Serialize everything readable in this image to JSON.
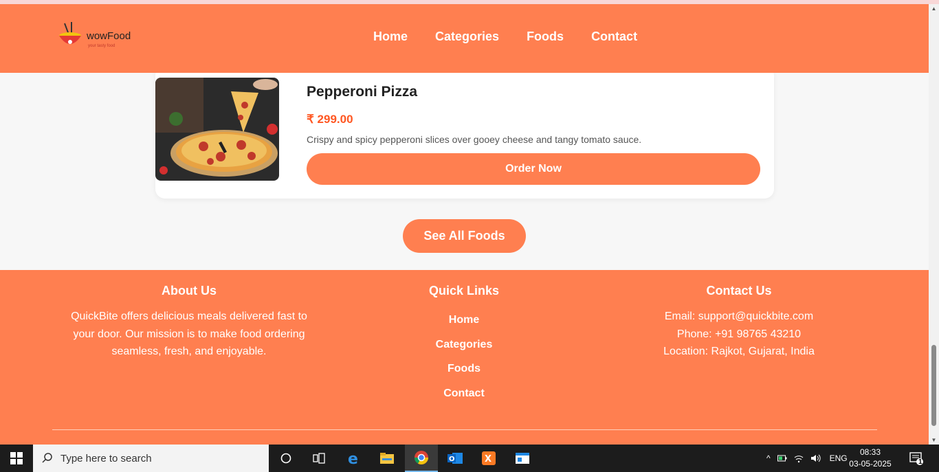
{
  "brand": {
    "name": "wowFood",
    "tagline": "your tasty food"
  },
  "nav": [
    "Home",
    "Categories",
    "Foods",
    "Contact"
  ],
  "food": {
    "title": "Pepperoni Pizza",
    "price": "₹ 299.00",
    "description": "Crispy and spicy pepperoni slices over gooey cheese and tangy tomato sauce.",
    "order_label": "Order Now"
  },
  "see_all_label": "See All Foods",
  "footer": {
    "about": {
      "heading": "About Us",
      "lines": [
        "QuickBite offers delicious meals delivered fast to",
        "your door. Our mission is to make food ordering",
        "seamless, fresh, and enjoyable."
      ]
    },
    "links": {
      "heading": "Quick Links",
      "items": [
        "Home",
        "Categories",
        "Foods",
        "Contact"
      ]
    },
    "contact": {
      "heading": "Contact Us",
      "email": "Email: support@quickbite.com",
      "phone": "Phone: +91 98765 43210",
      "location": "Location: Rajkot, Gujarat, India"
    }
  },
  "taskbar": {
    "search_placeholder": "Type here to search",
    "lang": "ENG",
    "time": "08:33",
    "date": "03-05-2025",
    "notification_count": "1"
  },
  "colors": {
    "accent": "#ff7f50",
    "price": "#ff5722"
  }
}
